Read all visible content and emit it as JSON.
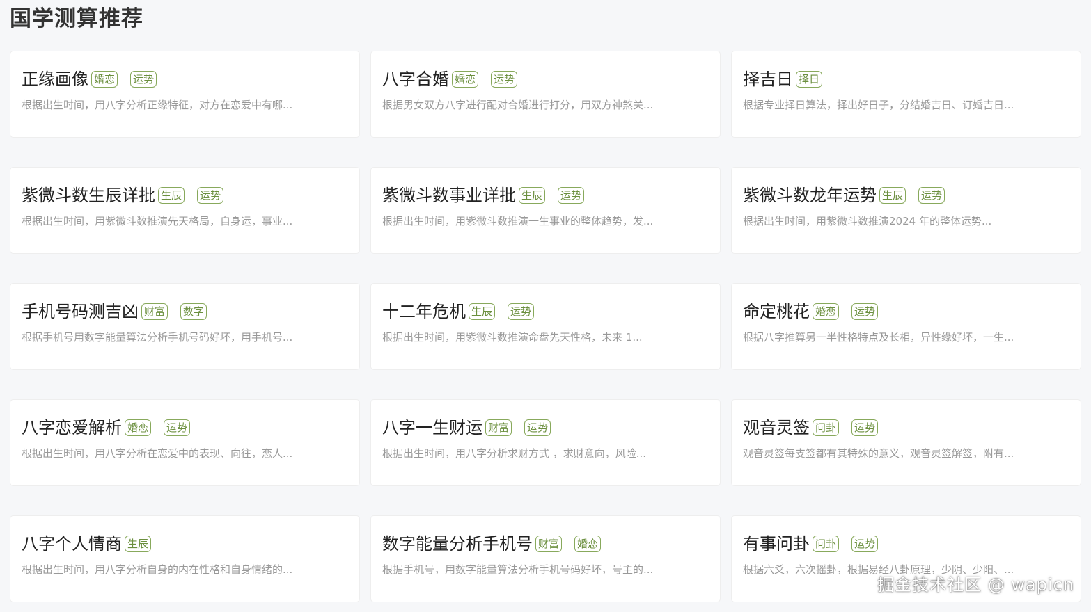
{
  "page": {
    "title": "国学测算推荐"
  },
  "cards": [
    {
      "title": "正缘画像",
      "tags": [
        "婚恋",
        "运势"
      ],
      "desc": "根据出生时间，用八字分析正缘特征，对方在恋爱中有哪..."
    },
    {
      "title": "八字合婚",
      "tags": [
        "婚恋",
        "运势"
      ],
      "desc": "根据男女双方八字进行配对合婚进行打分，用双方神煞关..."
    },
    {
      "title": "择吉日",
      "tags": [
        "择日"
      ],
      "desc": "根据专业择日算法，择出好日子，分结婚吉日、订婚吉日..."
    },
    {
      "title": "紫微斗数生辰详批",
      "tags": [
        "生辰",
        "运势"
      ],
      "desc": "根据出生时间，用紫微斗数推演先天格局，自身运，事业..."
    },
    {
      "title": "紫微斗数事业详批",
      "tags": [
        "生辰",
        "运势"
      ],
      "desc": "根据出生时间，用紫微斗数推演一生事业的整体趋势，发..."
    },
    {
      "title": "紫微斗数龙年运势",
      "tags": [
        "生辰",
        "运势"
      ],
      "desc": "根据出生时间，用紫微斗数推演2024 年的整体运势..."
    },
    {
      "title": "手机号码测吉凶",
      "tags": [
        "财富",
        "数字"
      ],
      "desc": "根据手机号用数字能量算法分析手机号码好坏，用手机号..."
    },
    {
      "title": "十二年危机",
      "tags": [
        "生辰",
        "运势"
      ],
      "desc": "根据出生时间，用紫微斗数推演命盘先天性格，未来 1..."
    },
    {
      "title": "命定桃花",
      "tags": [
        "婚恋",
        "运势"
      ],
      "desc": "根据八字推算另一半性格特点及长相，异性缘好坏，一生..."
    },
    {
      "title": "八字恋爱解析",
      "tags": [
        "婚恋",
        "运势"
      ],
      "desc": "根据出生时间，用八字分析在恋爱中的表现、向往，恋人..."
    },
    {
      "title": "八字一生财运",
      "tags": [
        "财富",
        "运势"
      ],
      "desc": "根据出生时间，用八字分析求财方式 ，求财意向，风险..."
    },
    {
      "title": "观音灵签",
      "tags": [
        "问卦",
        "运势"
      ],
      "desc": "观音灵签每支签都有其特殊的意义，观音灵签解签，附有..."
    },
    {
      "title": "八字个人情商",
      "tags": [
        "生辰"
      ],
      "desc": "根据出生时间，用八字分析自身的内在性格和自身情绪的..."
    },
    {
      "title": "数字能量分析手机号",
      "tags": [
        "财富",
        "婚恋"
      ],
      "desc": "根据手机号，用数字能量算法分析手机号码好坏，号主的..."
    },
    {
      "title": "有事问卦",
      "tags": [
        "问卦",
        "运势"
      ],
      "desc": "根据六爻，六次摇卦，根据易经八卦原理，少阴、少阳、..."
    }
  ],
  "watermark": "掘金技术社区 @ wapicn"
}
